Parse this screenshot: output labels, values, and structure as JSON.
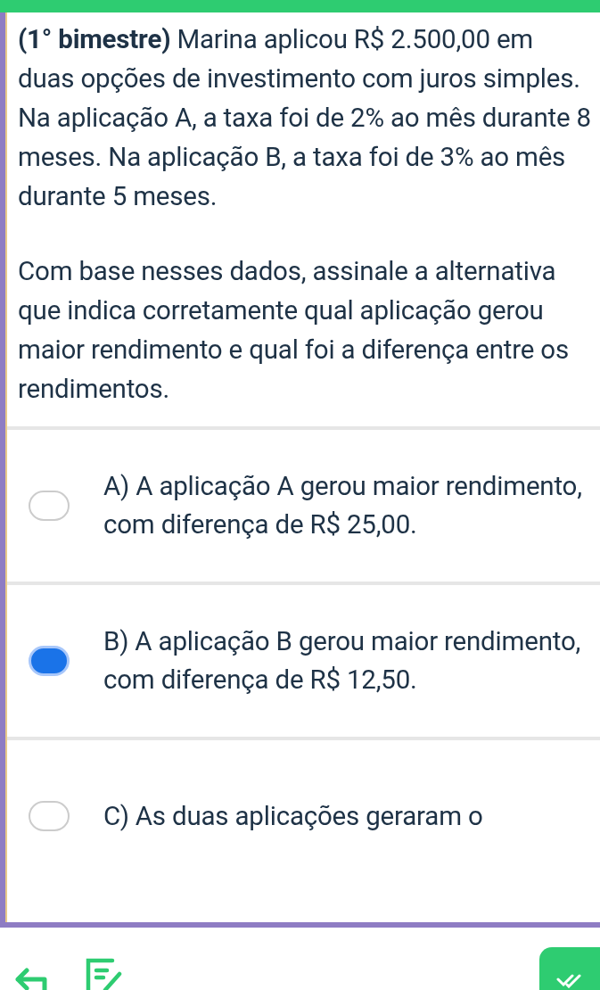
{
  "question": {
    "paragraphs": [
      "**(1° bimestre)** Marina aplicou R$ 2.500,00 em duas opções de investimento com juros simples. Na aplicação A, a taxa foi de 2% ao mês durante 8 meses. Na aplicação B, a taxa foi de 3% ao mês durante 5 meses.",
      "Com base nesses dados, assinale a alternativa que indica corretamente qual aplicação gerou maior rendimento e qual foi a diferença entre os rendimentos."
    ]
  },
  "options": [
    {
      "text": "A) A aplicação A gerou maior rendimento, com diferença de R$ 25,00.",
      "selected": false
    },
    {
      "text": "B) A aplicação B gerou maior rendimento, com diferença de R$ 12,50.",
      "selected": true
    },
    {
      "text": "C) As duas aplicações geraram o",
      "selected": false
    }
  ]
}
